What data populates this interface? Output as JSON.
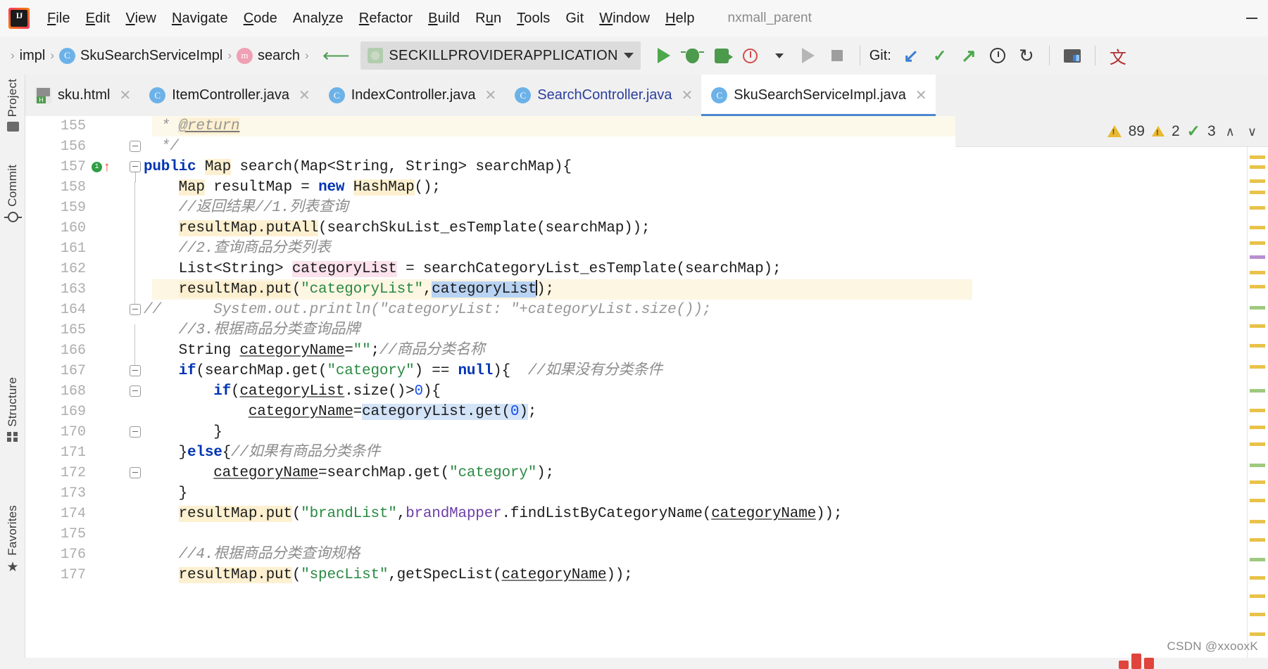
{
  "window": {
    "project_name": "nxmall_parent",
    "minimize_label": "—"
  },
  "menubar": {
    "logo_name": "intellij-idea-logo",
    "items": [
      {
        "label": "File",
        "mnemonic": "F"
      },
      {
        "label": "Edit",
        "mnemonic": "E"
      },
      {
        "label": "View",
        "mnemonic": "V"
      },
      {
        "label": "Navigate",
        "mnemonic": "N"
      },
      {
        "label": "Code",
        "mnemonic": "C"
      },
      {
        "label": "Analyze",
        "mnemonic": "y"
      },
      {
        "label": "Refactor",
        "mnemonic": "R"
      },
      {
        "label": "Build",
        "mnemonic": "B"
      },
      {
        "label": "Run",
        "mnemonic": "u"
      },
      {
        "label": "Tools",
        "mnemonic": "T"
      },
      {
        "label": "Git",
        "mnemonic": ""
      },
      {
        "label": "Window",
        "mnemonic": "W"
      },
      {
        "label": "Help",
        "mnemonic": "H"
      }
    ]
  },
  "breadcrumb": {
    "items": [
      "impl",
      "SkuSearchServiceImpl",
      "search"
    ],
    "class_icon_letter": "C",
    "method_icon_letter": "m",
    "separator": "›"
  },
  "toolbar": {
    "run_config": "SECKILLPROVIDERAPPLICATION",
    "git_label": "Git:",
    "buttons": [
      "run-button",
      "debug-button",
      "run-with-coverage-button",
      "profile-button",
      "rerun-button",
      "stop-button"
    ],
    "git_buttons": [
      "update-project",
      "commit",
      "push",
      "history",
      "rollback"
    ],
    "extra_buttons": [
      "project-structure",
      "translate"
    ]
  },
  "tabs": [
    {
      "label": "sku.html",
      "icon": "html-file-icon",
      "active": false,
      "modified": false
    },
    {
      "label": "ItemController.java",
      "icon": "java-class-icon",
      "active": false,
      "modified": false
    },
    {
      "label": "IndexController.java",
      "icon": "java-class-icon",
      "active": false,
      "modified": false
    },
    {
      "label": "SearchController.java",
      "icon": "java-class-icon",
      "active": false,
      "highlighted": true
    },
    {
      "label": "SkuSearchServiceImpl.java",
      "icon": "java-class-icon",
      "active": true,
      "modified": false
    }
  ],
  "left_toolwindows": [
    {
      "label": "Project",
      "icon": "folder-icon"
    },
    {
      "label": "Commit",
      "icon": "commit-icon"
    },
    {
      "label": "Structure",
      "icon": "structure-icon"
    },
    {
      "label": "Favorites",
      "icon": "star-icon"
    }
  ],
  "inspector": {
    "warnings": "89",
    "weak_warnings": "2",
    "checks": "3",
    "prev_label": "∧",
    "next_label": "∨"
  },
  "editor": {
    "first_line": 155,
    "lines": [
      {
        "no": "155",
        "text": "     * @return"
      },
      {
        "no": "156",
        "text": "     */"
      },
      {
        "no": "157",
        "text": "    public Map search(Map<String, String> searchMap){"
      },
      {
        "no": "158",
        "text": "        Map resultMap = new HashMap();"
      },
      {
        "no": "159",
        "text": "        //返回结果//1.列表查询"
      },
      {
        "no": "160",
        "text": "        resultMap.putAll(searchSkuList_esTemplate(searchMap));"
      },
      {
        "no": "161",
        "text": "        //2.查询商品分类列表"
      },
      {
        "no": "162",
        "text": "        List<String> categoryList = searchCategoryList_esTemplate(searchMap);"
      },
      {
        "no": "163",
        "text": "        resultMap.put(\"categoryList\",categoryList);"
      },
      {
        "no": "164",
        "text": "//        System.out.println(\"categoryList: \"+categoryList.size());"
      },
      {
        "no": "165",
        "text": "        //3.根据商品分类查询品牌"
      },
      {
        "no": "166",
        "text": "        String categoryName=\"\";//商品分类名称"
      },
      {
        "no": "167",
        "text": "        if(searchMap.get(\"category\") == null){  //如果没有分类条件"
      },
      {
        "no": "168",
        "text": "            if(categoryList.size()>0){"
      },
      {
        "no": "169",
        "text": "                categoryName=categoryList.get(0);"
      },
      {
        "no": "170",
        "text": "            }"
      },
      {
        "no": "171",
        "text": "        }else{//如果有商品分类条件"
      },
      {
        "no": "172",
        "text": "            categoryName=searchMap.get(\"category\");"
      },
      {
        "no": "173",
        "text": "        }"
      },
      {
        "no": "174",
        "text": "        resultMap.put(\"brandList\",brandMapper.findListByCategoryName(categoryName));"
      },
      {
        "no": "175",
        "text": ""
      },
      {
        "no": "176",
        "text": "        //4.根据商品分类查询规格"
      },
      {
        "no": "177",
        "text": "        resultMap.put(\"specList\",getSpecList(categoryName));"
      }
    ]
  },
  "watermark": {
    "text": "CSDN @xxooxK"
  },
  "colors": {
    "accent_blue": "#4a87d0",
    "keyword": "#0033b3",
    "string": "#2a8a43",
    "comment": "#969696",
    "selection": "#b9d3f3",
    "warning": "#e8b931",
    "success": "#4ba84b"
  }
}
